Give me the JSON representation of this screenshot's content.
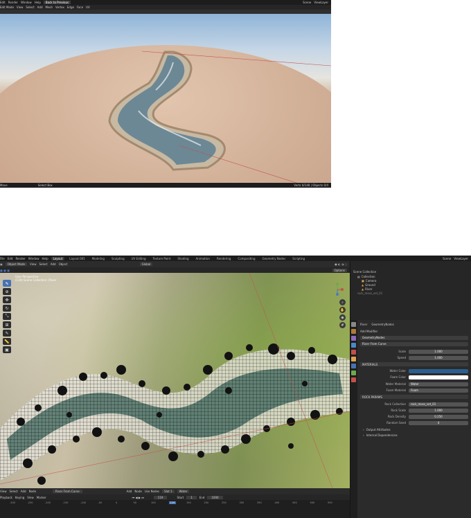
{
  "top_shot": {
    "menu": [
      "Edit",
      "Render",
      "Window",
      "Help"
    ],
    "workspace": "Back to Previous",
    "scene": "Scene",
    "view_layer": "ViewLayer",
    "mode": "Edit Mode",
    "header_menu": [
      "View",
      "Select",
      "Add",
      "Mesh",
      "Vertex",
      "Edge",
      "Face",
      "UV"
    ],
    "status_left": "Move",
    "status_mid": "Select Box",
    "status_right": "Verts 0/148 | Objects 0/4"
  },
  "bottom_shot": {
    "menu": [
      "File",
      "Edit",
      "Render",
      "Window",
      "Help"
    ],
    "workspace_tabs": [
      "Layout",
      "Layout.001",
      "Modeling",
      "Sculpting",
      "UV Editing",
      "Texture Paint",
      "Shading",
      "Animation",
      "Rendering",
      "Compositing",
      "Geometry Nodes",
      "Scripting"
    ],
    "active_tab": "Layout",
    "scene": "Scene",
    "view_layer": "ViewLayer",
    "mode": "Object Mode",
    "header_menu": [
      "View",
      "Select",
      "Add",
      "Object"
    ],
    "transform": "Global",
    "options": "Options",
    "viewport_info": [
      "User Perspective",
      "(119) Scene Collection | River"
    ],
    "outliner": {
      "title": "Scene Collection",
      "items": [
        "Collection",
        "Camera",
        "Ground",
        "River",
        "rock_moss_set_01"
      ]
    },
    "properties": {
      "object": "River",
      "modifier_tab": "GeometryNodes",
      "add_modifier": "Add Modifier",
      "modifier_name": "GeometryNodes",
      "node_group": "River From Curve",
      "rows": [
        {
          "label": "Scale",
          "value": "1.000"
        },
        {
          "label": "Speed",
          "value": "1.000"
        }
      ],
      "materials_header": "MATERIALS",
      "water_color": "Water Color",
      "foam_color": "Foam Color",
      "water_material_label": "Water Material",
      "water_material": "Water",
      "foam_material_label": "Foam Material",
      "foam_material": "Foam",
      "rock_header": "ROCK PARAMS",
      "rock_collection_label": "Rock Collection",
      "rock_collection": "rock_moss_set_01",
      "rock_scale_label": "Rock Scale",
      "rock_scale": "1.000",
      "rock_density_label": "Rock Density",
      "rock_density": "0.250",
      "random_seed_label": "Random Seed",
      "random_seed": "4",
      "output": "Output Attributes",
      "deps": "Internal Dependencies"
    },
    "node_header": [
      "View",
      "Select",
      "Add",
      "Node"
    ],
    "node_group": "River From Curve",
    "node_right": [
      "Add",
      "Node",
      "Use Nodes",
      "Slot 1",
      "Water"
    ],
    "timeline": {
      "menu": [
        "Playback",
        "Keying",
        "View",
        "Marker"
      ],
      "current": "119",
      "start_label": "Start",
      "start": "1",
      "end_label": "End",
      "end": "1000"
    },
    "ruler": [
      "-300",
      "-250",
      "-200",
      "-150",
      "-100",
      "-50",
      "0",
      "50",
      "100",
      "119",
      "150",
      "200",
      "250",
      "300",
      "350",
      "400",
      "450",
      "500",
      "550"
    ]
  },
  "colors": {
    "accent": "#4772b3",
    "water": "#2a5f8f",
    "foam": "#ffffff"
  }
}
